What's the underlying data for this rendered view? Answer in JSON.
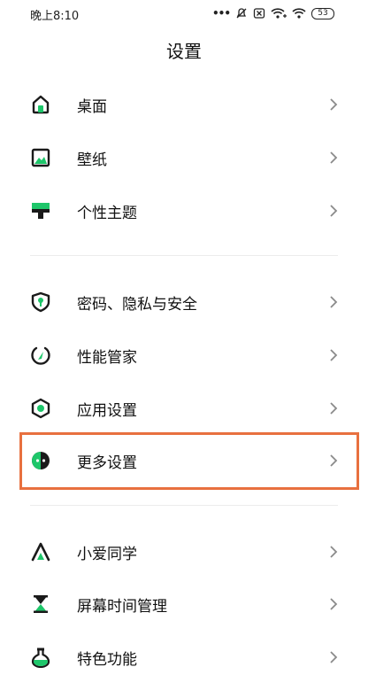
{
  "status_bar": {
    "time": "晚上8:10",
    "battery": "53"
  },
  "header": {
    "title": "设置"
  },
  "sections": [
    {
      "items": [
        {
          "label": "桌面",
          "icon": "home-icon"
        },
        {
          "label": "壁纸",
          "icon": "wallpaper-icon"
        },
        {
          "label": "个性主题",
          "icon": "theme-icon"
        }
      ]
    },
    {
      "items": [
        {
          "label": "密码、隐私与安全",
          "icon": "shield-icon"
        },
        {
          "label": "性能管家",
          "icon": "performance-icon"
        },
        {
          "label": "应用设置",
          "icon": "app-settings-icon"
        },
        {
          "label": "更多设置",
          "icon": "more-settings-icon",
          "highlighted": true
        }
      ]
    },
    {
      "items": [
        {
          "label": "小爱同学",
          "icon": "xiaoai-icon"
        },
        {
          "label": "屏幕时间管理",
          "icon": "hourglass-icon"
        },
        {
          "label": "特色功能",
          "icon": "flask-icon"
        }
      ]
    }
  ],
  "colors": {
    "accent_green": "#1ec66a",
    "icon_dark": "#1a1a1a",
    "highlight_border": "#e8703f"
  }
}
